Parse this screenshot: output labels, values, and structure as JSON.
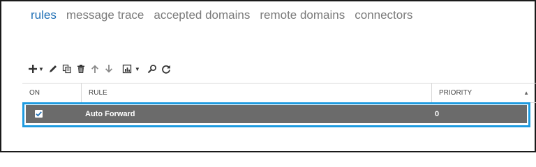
{
  "tabs": [
    {
      "label": "rules",
      "active": true
    },
    {
      "label": "message trace",
      "active": false
    },
    {
      "label": "accepted domains",
      "active": false
    },
    {
      "label": "remote domains",
      "active": false
    },
    {
      "label": "connectors",
      "active": false
    }
  ],
  "toolbar": {
    "icons": [
      "plus-icon",
      "pencil-icon",
      "copy-icon",
      "trash-icon",
      "arrow-up-icon",
      "arrow-down-icon",
      "report-icon",
      "search-icon",
      "refresh-icon"
    ]
  },
  "table": {
    "headers": {
      "on": "ON",
      "rule": "RULE",
      "priority": "PRIORITY"
    },
    "rows": [
      {
        "on": true,
        "rule": "Auto Forward",
        "priority": "0"
      }
    ]
  },
  "colors": {
    "accent": "#1f6fb5",
    "selected_row": "#6b6b6b",
    "highlight_border": "#1e9be0"
  }
}
